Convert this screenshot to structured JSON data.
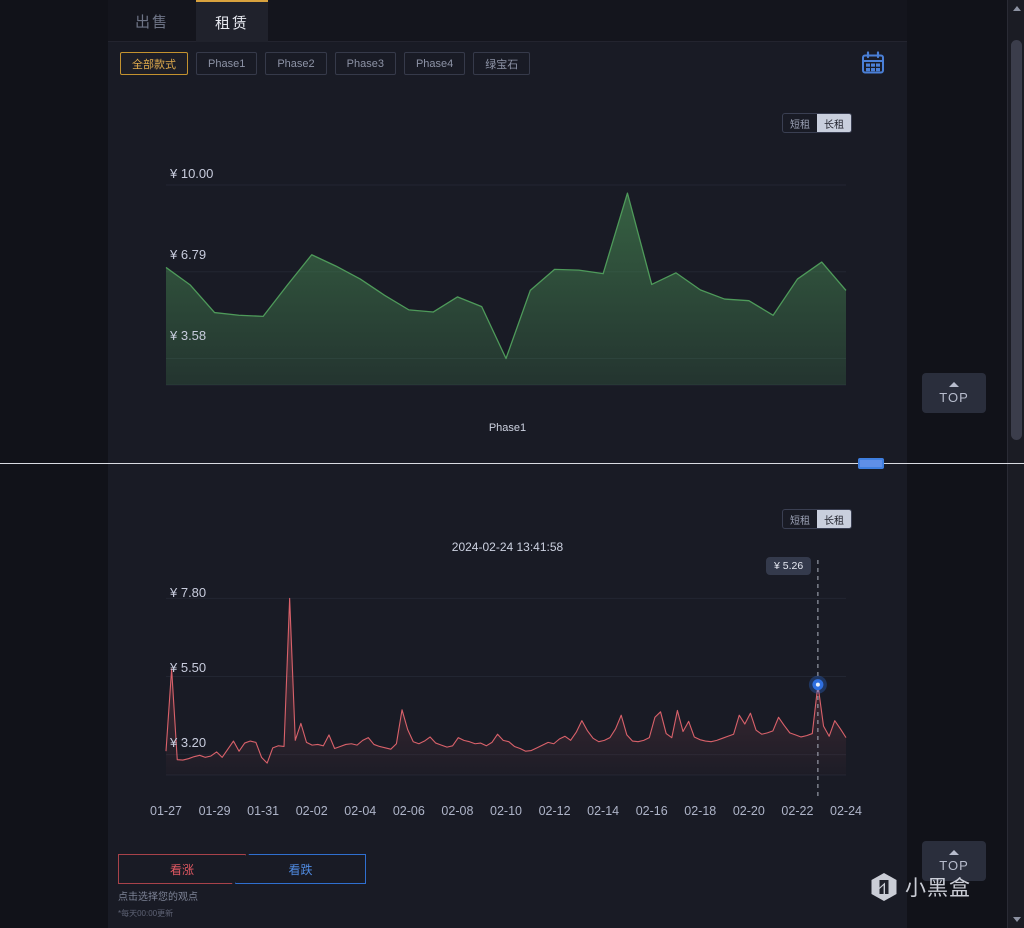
{
  "tabs": [
    {
      "label": "出售",
      "name": "tab-sell",
      "active": false
    },
    {
      "label": "租赁",
      "name": "tab-rent",
      "active": true
    }
  ],
  "filters": [
    {
      "label": "全部款式",
      "active": true
    },
    {
      "label": "Phase1",
      "active": false
    },
    {
      "label": "Phase2",
      "active": false
    },
    {
      "label": "Phase3",
      "active": false
    },
    {
      "label": "Phase4",
      "active": false
    },
    {
      "label": "绿宝石",
      "active": false
    }
  ],
  "icons": {
    "calendar": "calendar-icon",
    "logo": "xiaoheihe-logo-icon"
  },
  "rent_toggle_top": {
    "short": "短租",
    "long": "长租",
    "selected": "长租"
  },
  "rent_toggle_bottom": {
    "short": "短租",
    "long": "长租",
    "selected": "长租"
  },
  "chart_top": {
    "caption": "Phase1",
    "y_labels": [
      "¥ 10.00",
      "¥ 6.79",
      "¥ 3.58"
    ]
  },
  "chart_bottom": {
    "timestamp": "2024-02-24 13:41:58",
    "tooltip_value": "¥ 5.26",
    "y_labels": [
      "¥ 7.80",
      "¥ 5.50",
      "¥ 3.20"
    ],
    "x_labels": [
      "01-27",
      "01-29",
      "01-31",
      "02-02",
      "02-04",
      "02-06",
      "02-08",
      "02-10",
      "02-12",
      "02-14",
      "02-16",
      "02-18",
      "02-20",
      "02-22",
      "02-24"
    ]
  },
  "opinion": {
    "up_label": "看涨",
    "down_label": "看跌",
    "hint": "点击选择您的观点",
    "update_note": "*每天00:00更新",
    "update_note_star": "*"
  },
  "top_buttons": [
    {
      "label": "TOP"
    },
    {
      "label": "TOP"
    }
  ],
  "watermark": {
    "text": "小黑盒"
  },
  "colors": {
    "accent_gold": "#d8a23e",
    "green_line": "#4e9a5a",
    "red_line": "#d9616a",
    "blue": "#4f8ae0",
    "bg": "#191b25"
  },
  "chart_data": [
    {
      "type": "area",
      "title": "Phase1",
      "id": "long-rent-price-chart",
      "series_color": "#4e9a5a",
      "ylabel": "",
      "xlabel": "",
      "ylim": [
        2.6,
        11.0
      ],
      "ytick_values": [
        10.0,
        6.79,
        3.58
      ],
      "ytick_labels": [
        "¥ 10.00",
        "¥ 6.79",
        "¥ 3.58"
      ],
      "grid": true,
      "legend": "none",
      "x": [
        0,
        1,
        2,
        3,
        4,
        5,
        6,
        7,
        8,
        9,
        10,
        11,
        12,
        13,
        14,
        15,
        16,
        17,
        18,
        19,
        20,
        21,
        22,
        23,
        24,
        25,
        26,
        27,
        28
      ],
      "values": [
        6.95,
        6.3,
        5.28,
        5.18,
        5.14,
        6.3,
        7.42,
        7.0,
        6.52,
        5.92,
        5.38,
        5.3,
        5.86,
        5.5,
        3.58,
        6.1,
        6.88,
        6.85,
        6.72,
        9.7,
        6.32,
        6.75,
        6.12,
        5.78,
        5.72,
        5.18,
        6.52,
        7.15,
        6.1
      ]
    },
    {
      "type": "area",
      "title": "",
      "id": "short-term-price-chart",
      "series_color": "#d9616a",
      "ylabel": "",
      "xlabel": "",
      "ylim": [
        2.6,
        8.4
      ],
      "ytick_values": [
        7.8,
        5.5,
        3.2
      ],
      "ytick_labels": [
        "¥ 7.80",
        "¥ 5.50",
        "¥ 3.20"
      ],
      "xtick_labels": [
        "01-27",
        "01-29",
        "01-31",
        "02-02",
        "02-04",
        "02-06",
        "02-08",
        "02-10",
        "02-12",
        "02-14",
        "02-16",
        "02-18",
        "02-20",
        "02-22",
        "02-24"
      ],
      "grid": true,
      "legend": "none",
      "marker": {
        "x_label": "02-24",
        "value": 5.26,
        "color": "#2f6fe0"
      },
      "annotation": "2024-02-24 13:41:58",
      "values": [
        3.3,
        5.72,
        3.05,
        3.04,
        3.08,
        3.14,
        3.18,
        3.12,
        3.16,
        3.28,
        3.12,
        3.36,
        3.6,
        3.3,
        3.54,
        3.6,
        3.56,
        3.12,
        2.95,
        3.4,
        3.46,
        3.44,
        7.8,
        3.62,
        4.12,
        3.56,
        3.48,
        3.5,
        3.46,
        3.78,
        3.38,
        3.44,
        3.5,
        3.52,
        3.48,
        3.62,
        3.7,
        3.5,
        3.44,
        3.4,
        3.36,
        3.52,
        4.52,
        3.94,
        3.58,
        3.52,
        3.6,
        3.72,
        3.54,
        3.48,
        3.42,
        3.46,
        3.7,
        3.62,
        3.58,
        3.52,
        3.54,
        3.46,
        3.56,
        3.8,
        3.62,
        3.58,
        3.44,
        3.38,
        3.3,
        3.32,
        3.4,
        3.48,
        3.56,
        3.52,
        3.66,
        3.74,
        3.62,
        3.86,
        4.2,
        3.9,
        3.68,
        3.58,
        3.62,
        3.7,
        3.96,
        4.36,
        3.78,
        3.6,
        3.58,
        3.62,
        3.7,
        4.3,
        4.46,
        3.82,
        3.7,
        4.5,
        3.88,
        4.18,
        3.72,
        3.64,
        3.6,
        3.58,
        3.62,
        3.68,
        3.74,
        3.8,
        4.36,
        4.1,
        4.42,
        3.92,
        3.8,
        3.84,
        3.9,
        4.3,
        4.06,
        3.84,
        3.78,
        3.72,
        3.76,
        3.82,
        5.26,
        4.04,
        3.74,
        4.2,
        3.96,
        3.7
      ]
    }
  ]
}
